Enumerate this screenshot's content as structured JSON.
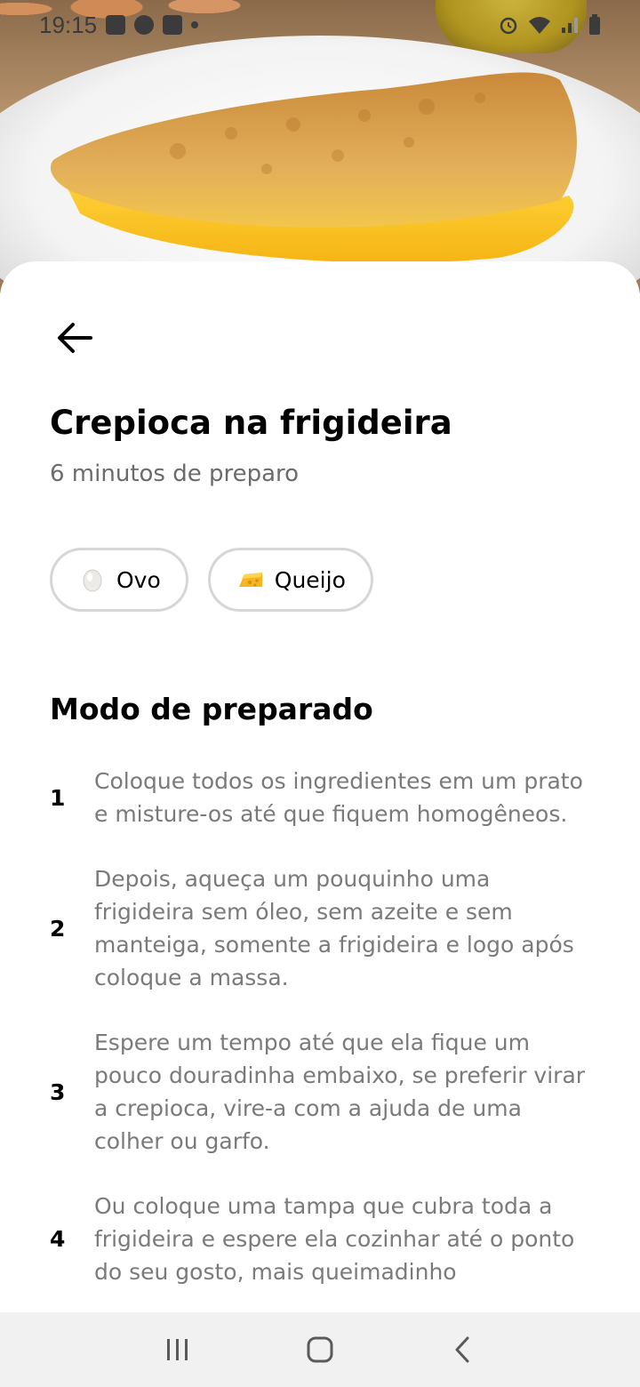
{
  "status_bar": {
    "time": "19:15",
    "left_icons": [
      "image-icon",
      "app-a-icon",
      "linkedin-icon",
      "dot-icon"
    ],
    "right_icons": [
      "alarm-icon",
      "wifi-icon",
      "signal-icon",
      "battery-icon"
    ]
  },
  "hero": {
    "image": "omelette-on-plate-photo"
  },
  "header": {
    "back_icon": "arrow-left-icon"
  },
  "recipe": {
    "title": "Crepioca na frigideira",
    "prep_time": "6 minutos de preparo"
  },
  "ingredients": [
    {
      "label": "Ovo",
      "icon": "egg-icon"
    },
    {
      "label": "Queijo",
      "icon": "cheese-icon"
    }
  ],
  "method": {
    "title": "Modo de preparado",
    "steps": [
      {
        "number": "1",
        "text": "Coloque todos os ingredientes em um prato e misture-os até que fiquem homogêneos."
      },
      {
        "number": "2",
        "text": "Depois, aqueça um pouquinho uma frigideira sem óleo, sem azeite e sem manteiga, somente a frigideira e logo após coloque a massa."
      },
      {
        "number": "3",
        "text": "Espere um tempo até que ela fique um pouco douradinha embaixo, se preferir virar a crepioca, vire-a com a ajuda de uma colher ou garfo."
      },
      {
        "number": "4",
        "text": "Ou coloque uma tampa que cubra toda a frigideira e espere ela cozinhar até o ponto do seu gosto, mais queimadinho"
      }
    ]
  },
  "nav_bar": {
    "icons": [
      "recents-icon",
      "home-icon",
      "back-icon"
    ]
  },
  "colors": {
    "text_primary": "#000000",
    "text_secondary": "#7a7a7a",
    "chip_border": "#d6d6d6",
    "nav_bg": "#f1f1f1"
  }
}
